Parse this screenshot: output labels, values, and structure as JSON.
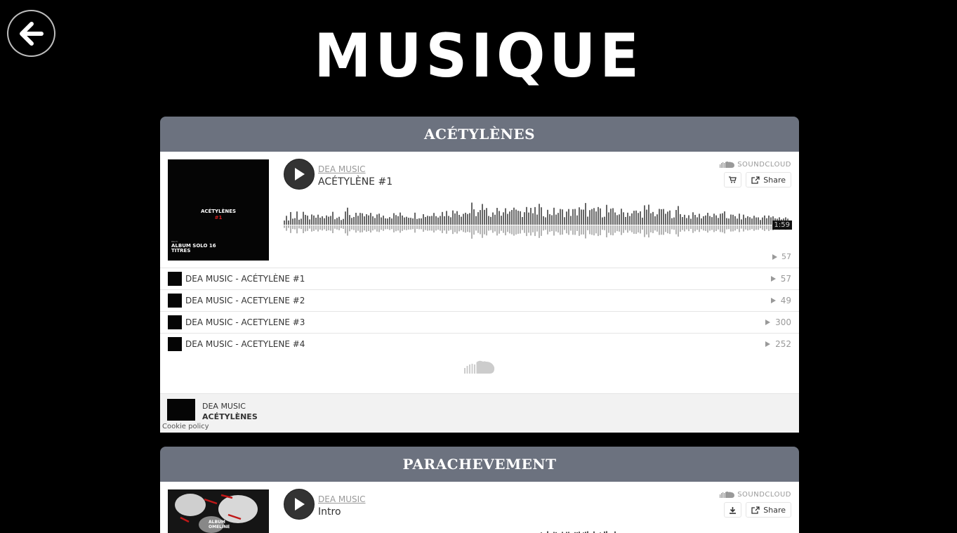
{
  "page": {
    "title": "MUSIQUE"
  },
  "sections": [
    {
      "header": "ACÉTYLÈNES",
      "player": {
        "artist": "DEA MUSIC",
        "track_title": "ACÉTYLÈNE #1",
        "brand": "SOUNDCLOUD",
        "share_label": "Share",
        "duration": "1:59",
        "plays": "57",
        "artwork": {
          "title_line1": "ACÉTYLÈNES",
          "title_line2": "#1",
          "subtitle_line1": "ALBUM SOLO 16",
          "subtitle_line2": "TITRES",
          "small_text": "DEA'S'"
        }
      },
      "tracks": [
        {
          "name": "DEA MUSIC - ACÉTYLÈNE #1",
          "plays": "57"
        },
        {
          "name": "DEA MUSIC - ACETYLENE #2",
          "plays": "49"
        },
        {
          "name": "DEA MUSIC - ACETYLENE #3",
          "plays": "300"
        },
        {
          "name": "DEA MUSIC - ACETYLENE #4",
          "plays": "252"
        }
      ],
      "footer": {
        "artist": "DEA MUSIC",
        "album": "ACÉTYLÈNES",
        "cookie": "Cookie policy"
      }
    },
    {
      "header": "PARACHEVEMENT",
      "player": {
        "artist": "DEA MUSIC",
        "track_title": "Intro",
        "brand": "SOUNDCLOUD",
        "share_label": "Share",
        "artwork": {
          "line1": "ALBUM",
          "line2": "OMELINE"
        }
      }
    }
  ],
  "colors": {
    "background": "#000000",
    "section_header": "#6c727f",
    "waveform_played": "#666666",
    "waveform_unplayed": "#b3b3b3"
  },
  "icons": {
    "back": "arrow-left-icon",
    "play": "play-icon",
    "cart": "cart-icon",
    "share": "share-icon",
    "download": "download-icon",
    "soundcloud": "soundcloud-icon"
  }
}
